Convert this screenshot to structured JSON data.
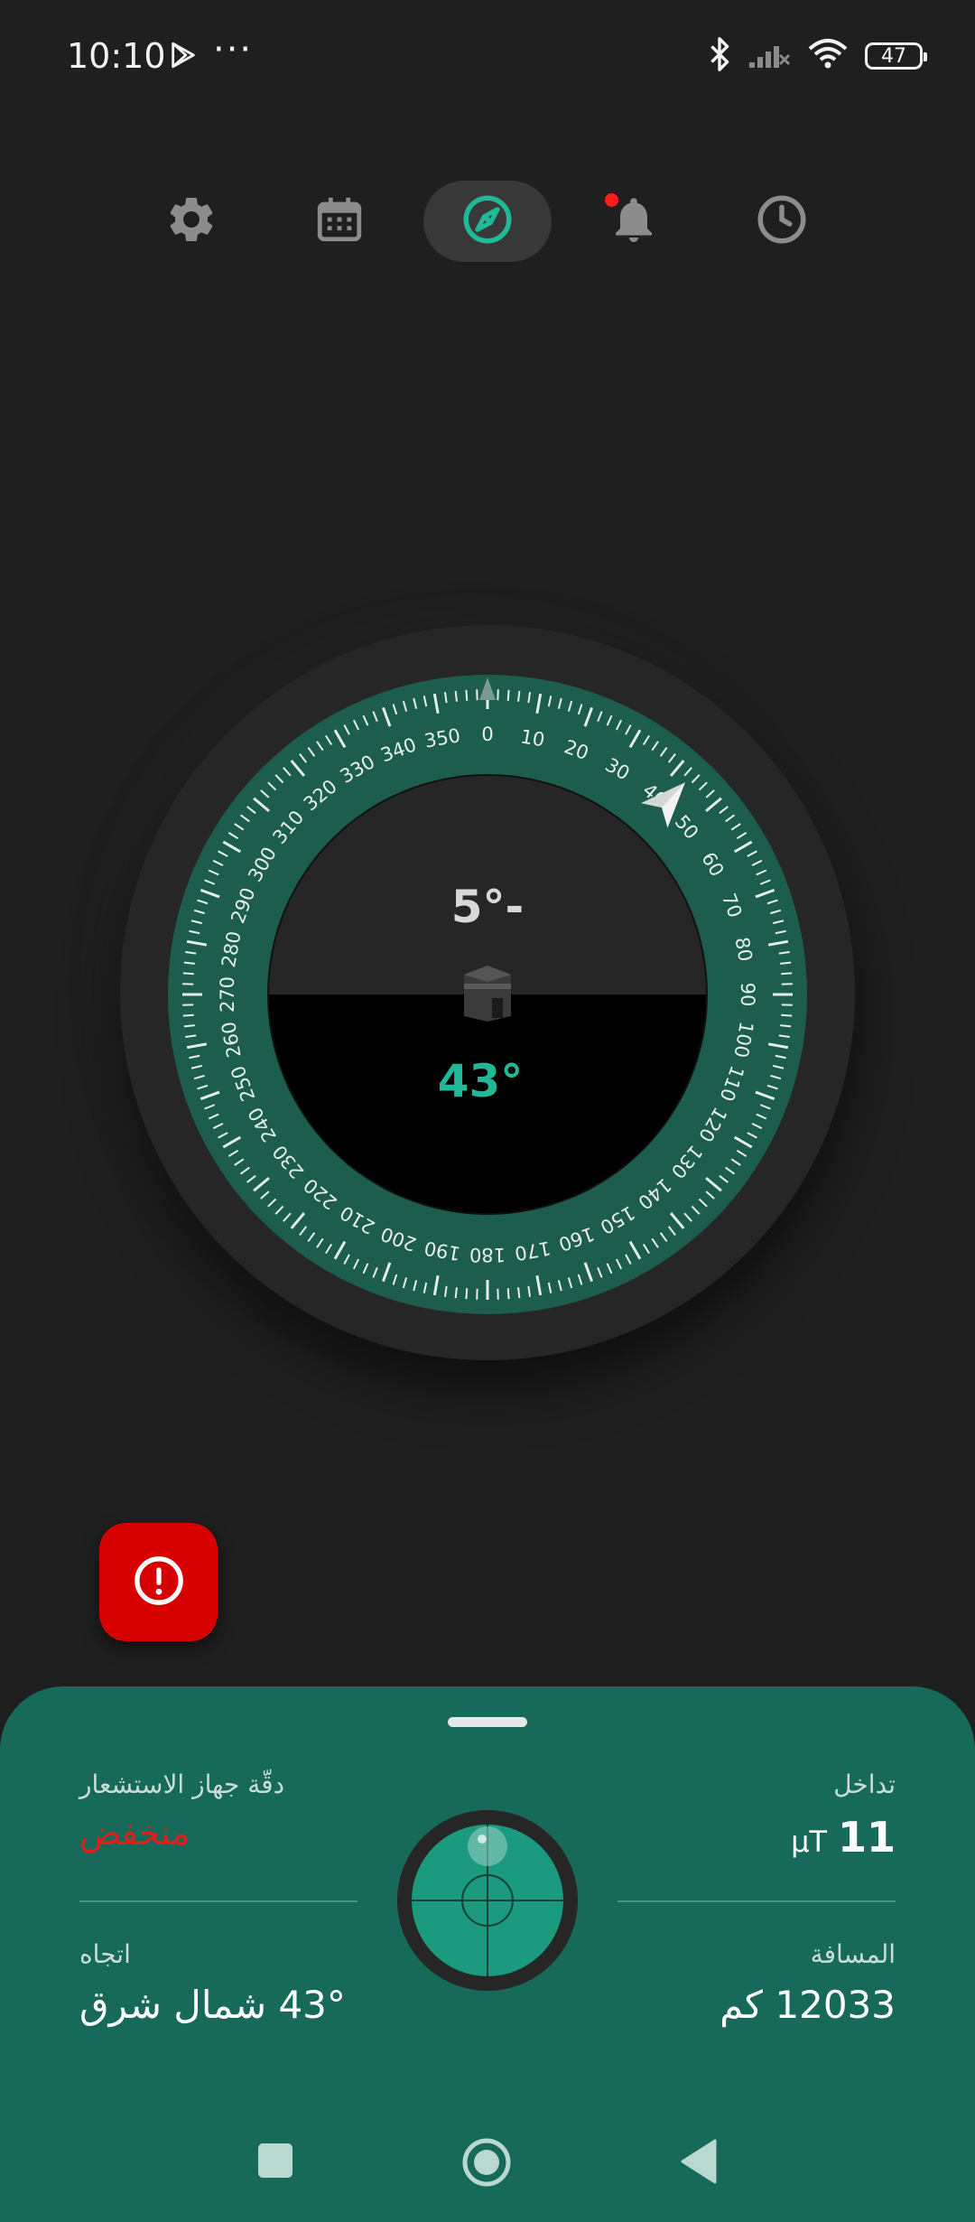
{
  "status_bar": {
    "time": "10:10",
    "notification_icons": [
      "play-store-icon",
      "more-dots-icon"
    ],
    "dots": "···",
    "right_icons": [
      "bluetooth-icon",
      "signal-off-icon",
      "wifi-icon"
    ],
    "battery": "47"
  },
  "top_nav": {
    "items": [
      {
        "name": "settings",
        "icon": "gear-icon"
      },
      {
        "name": "calendar",
        "icon": "calendar-icon"
      },
      {
        "name": "qibla-compass",
        "icon": "compass-icon",
        "active": true
      },
      {
        "name": "notifications",
        "icon": "bell-icon",
        "has_badge": true
      },
      {
        "name": "prayer-times",
        "icon": "clock-icon"
      }
    ]
  },
  "compass": {
    "pitch": "5°-",
    "heading": "43°",
    "heading_value": 43,
    "dial_labels": [
      "0",
      "10",
      "20",
      "30",
      "40",
      "50",
      "60",
      "70",
      "80",
      "90",
      "100",
      "110",
      "120",
      "130",
      "140",
      "150",
      "160",
      "170",
      "180",
      "190",
      "200",
      "210",
      "220",
      "230",
      "240",
      "250",
      "260",
      "270",
      "280",
      "290",
      "300",
      "310",
      "320",
      "330",
      "340",
      "350"
    ],
    "qibla_icon": "kaaba-icon",
    "colors": {
      "ring": "#1c5d4d",
      "accent": "#21b89a"
    }
  },
  "alert_button": {
    "icon": "alert-circle-icon",
    "color": "#d60000"
  },
  "info_sheet": {
    "sensor_accuracy_label": "دقّة جهاز الاستشعار",
    "sensor_accuracy_value": "منخفض",
    "interference_label": "تداخل",
    "interference_value": "11",
    "interference_unit": "µT",
    "direction_label": "اتجاه",
    "direction_value": "43° شمال شرق",
    "distance_label": "المسافة",
    "distance_value": "12033 كم",
    "background": "#17695a"
  },
  "nav_bar": {
    "buttons": [
      "recents-button",
      "home-button",
      "back-button"
    ]
  }
}
